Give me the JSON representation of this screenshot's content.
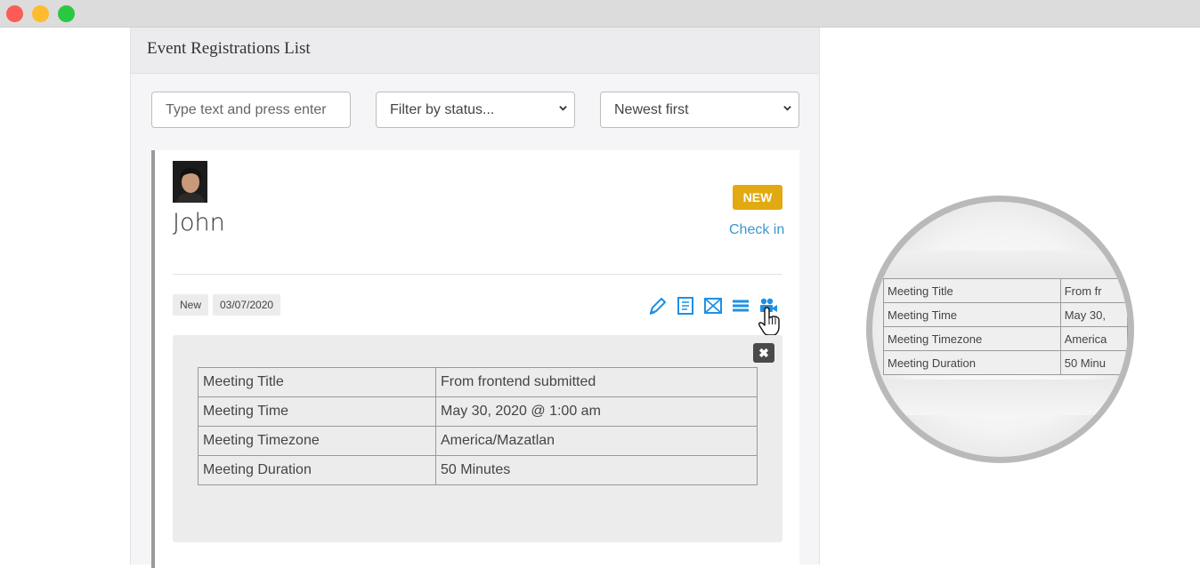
{
  "panel": {
    "title": "Event Registrations List"
  },
  "filters": {
    "search_placeholder": "Type text and press enter",
    "status_value": "Filter by status...",
    "sort_value": "Newest first"
  },
  "registration": {
    "name": "John",
    "status_badge": "NEW",
    "checkin_label": "Check in",
    "status_tag": "New",
    "date_tag": "03/07/2020",
    "action_icons": [
      "edit-icon",
      "document-icon",
      "mail-icon",
      "list-icon",
      "video-camera-icon"
    ],
    "close_label": "✖",
    "details": [
      {
        "key": "Meeting Title",
        "value": "From frontend submitted"
      },
      {
        "key": "Meeting Time",
        "value": "May 30, 2020 @ 1:00 am"
      },
      {
        "key": "Meeting Timezone",
        "value": "America/Mazatlan"
      },
      {
        "key": "Meeting Duration",
        "value": "50 Minutes"
      }
    ]
  },
  "magnifier": {
    "rows": [
      {
        "key": "Meeting Title",
        "value": "From fr"
      },
      {
        "key": "Meeting Time",
        "value": "May 30,"
      },
      {
        "key": "Meeting Timezone",
        "value": "America"
      },
      {
        "key": "Meeting Duration",
        "value": "50 Minu"
      }
    ]
  },
  "colors": {
    "badge_new": "#e2aa11",
    "link": "#3a97d4",
    "icon_blue": "#1e90e6"
  }
}
